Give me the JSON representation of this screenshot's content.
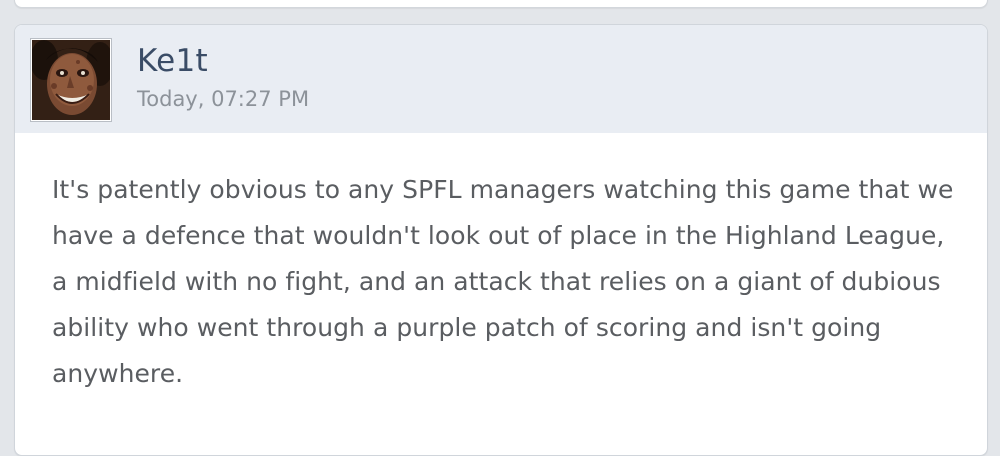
{
  "post": {
    "username": "Ke1t",
    "timestamp": "Today, 07:27 PM",
    "avatar_icon": "user-avatar-photo",
    "body": "It's patently obvious to any SPFL managers watching this game that we have a defence that wouldn't look out of place in the Highland League, a midfield with no fight, and an attack that relies on a giant of dubious ability who went through a purple patch of scoring and isn't going anywhere."
  },
  "colors": {
    "page_background": "#e3e6ea",
    "header_background": "#e9edf3",
    "username": "#3a4c66",
    "timestamp": "#8c9299",
    "body_text": "#5a5d61"
  }
}
